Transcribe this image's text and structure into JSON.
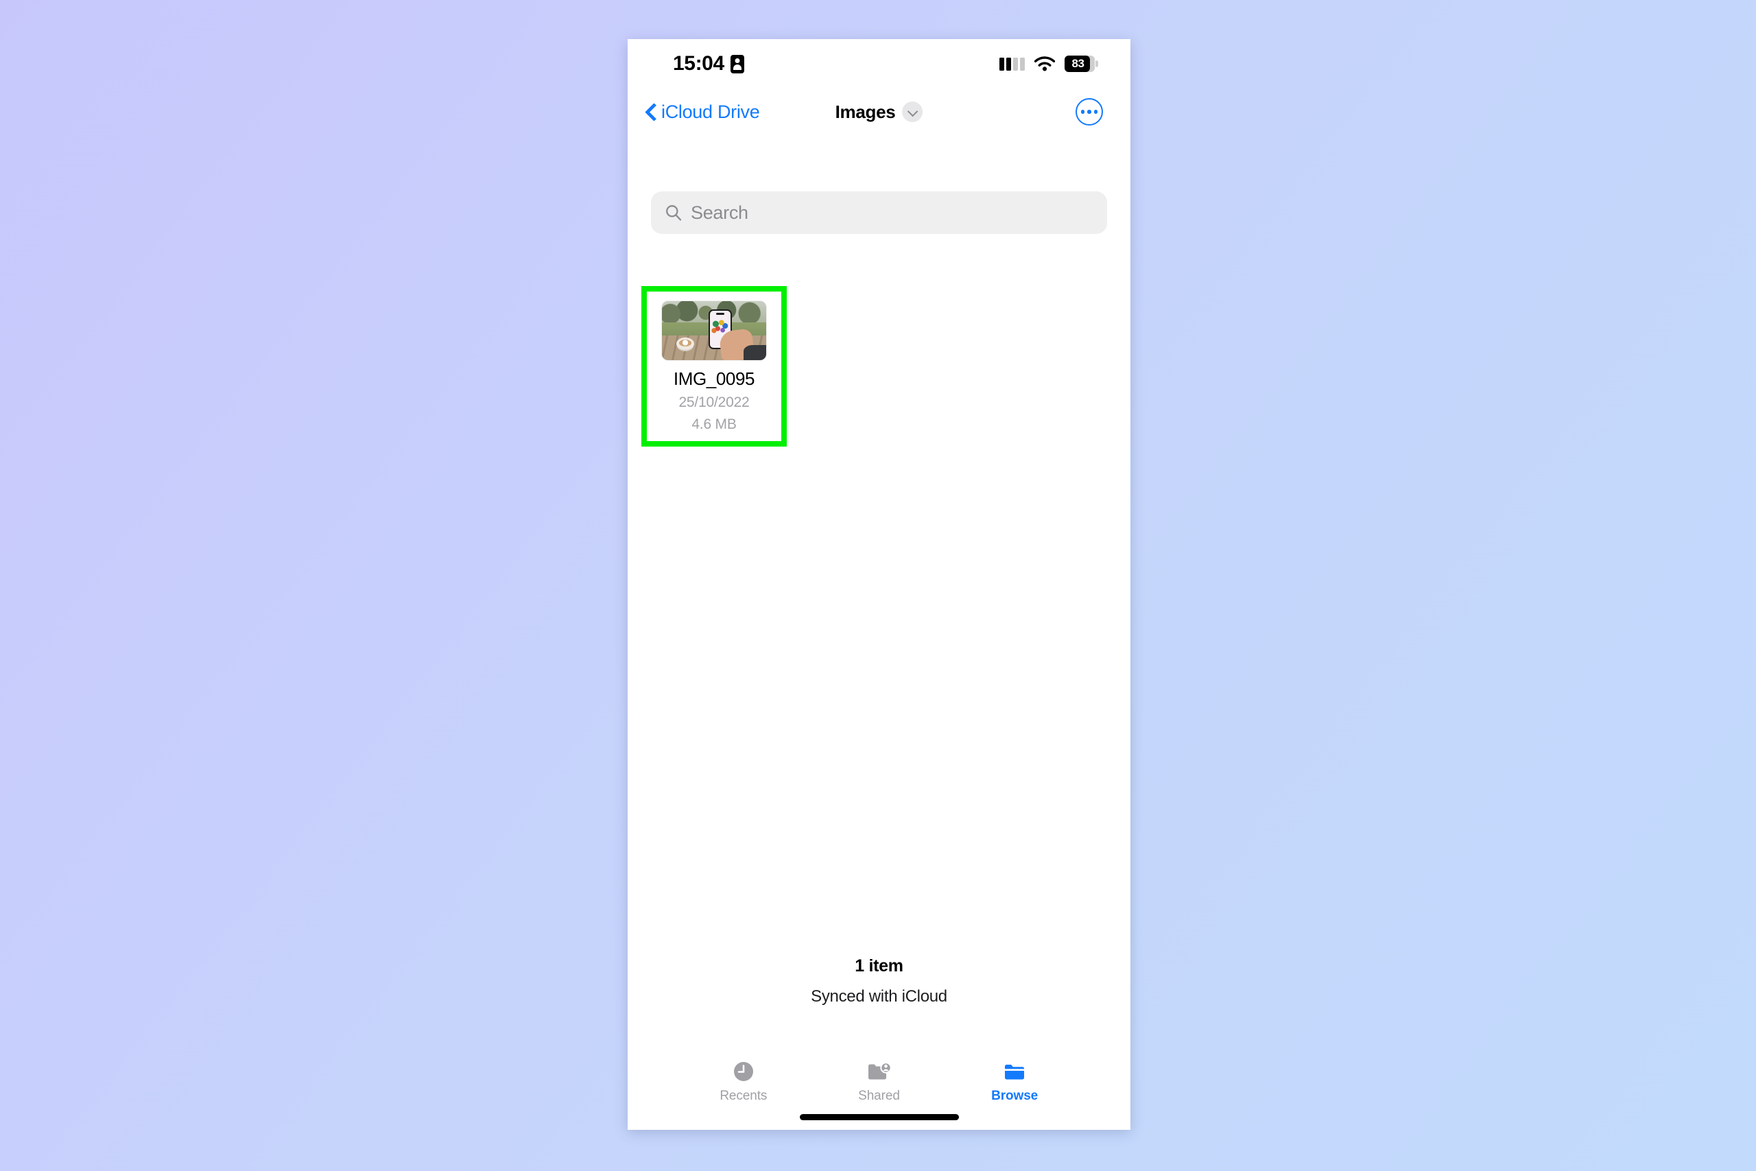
{
  "background": {
    "gradient_from": "#c7c7fc",
    "gradient_to": "#c2dafc"
  },
  "status_bar": {
    "time": "15:04",
    "person_badge_icon": "person-badge-icon",
    "cellular_icon": "cellular-icon",
    "wifi_icon": "wifi-icon",
    "battery_icon": "battery-icon",
    "battery_level": "83",
    "battery_percent": 83
  },
  "nav_bar": {
    "back_icon": "chevron-left-icon",
    "back_label": "iCloud Drive",
    "title": "Images",
    "folder_menu_icon": "chevron-down-icon",
    "more_icon": "ellipsis-circle-icon",
    "accent_color": "#137afc"
  },
  "search": {
    "icon": "search-icon",
    "placeholder": "Search",
    "value": ""
  },
  "files": [
    {
      "name": "IMG_0095",
      "date": "25/10/2022",
      "size": "4.6 MB",
      "thumbnail_alt": "hand holding iPhone over wooden picnic table with latte in a park",
      "highlighted": true,
      "highlight_color": "#00ef00"
    }
  ],
  "footer": {
    "item_count": "1 item",
    "sync_status": "Synced with iCloud"
  },
  "tabs": [
    {
      "label": "Recents",
      "icon": "clock-icon",
      "active": false
    },
    {
      "label": "Shared",
      "icon": "shared-folder-icon",
      "active": false
    },
    {
      "label": "Browse",
      "icon": "folder-icon",
      "active": true
    }
  ]
}
